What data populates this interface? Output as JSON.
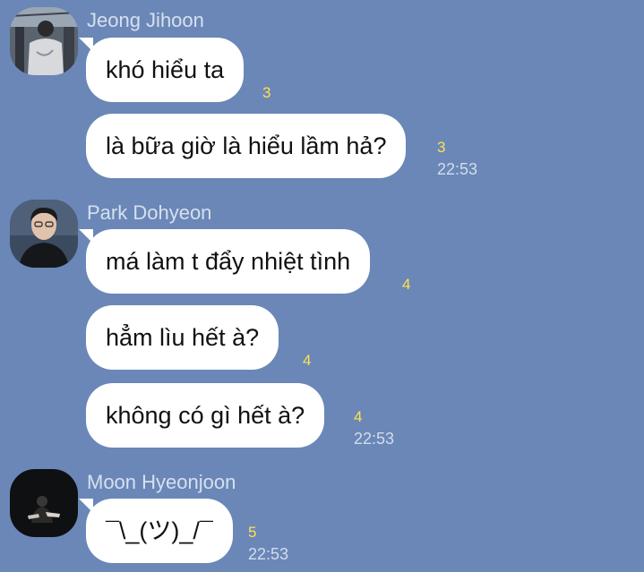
{
  "theme": {
    "background": "#6a87b7",
    "bubble": "#ffffff",
    "unread_color": "#ffe14d",
    "meta_color": "#d3ddeb"
  },
  "groups": [
    {
      "sender": "Jeong Jihoon",
      "avatar_icon": "user-avatar-photo",
      "messages": [
        {
          "text": "khó hiểu ta",
          "unread": "3",
          "time": ""
        },
        {
          "text": "là bữa giờ là hiểu lầm hả?",
          "unread": "3",
          "time": "22:53"
        }
      ]
    },
    {
      "sender": "Park Dohyeon",
      "avatar_icon": "user-avatar-photo",
      "messages": [
        {
          "text": "má làm t đẩy nhiệt tình",
          "unread": "4",
          "time": ""
        },
        {
          "text": "hẳm lìu hết à?",
          "unread": "4",
          "time": ""
        },
        {
          "text": "không có gì hết à?",
          "unread": "4",
          "time": "22:53"
        }
      ]
    },
    {
      "sender": "Moon Hyeonjoon",
      "avatar_icon": "user-avatar-photo",
      "messages": [
        {
          "text": "¯\\_(ツ)_/¯",
          "unread": "5",
          "time": "22:53"
        }
      ]
    }
  ]
}
